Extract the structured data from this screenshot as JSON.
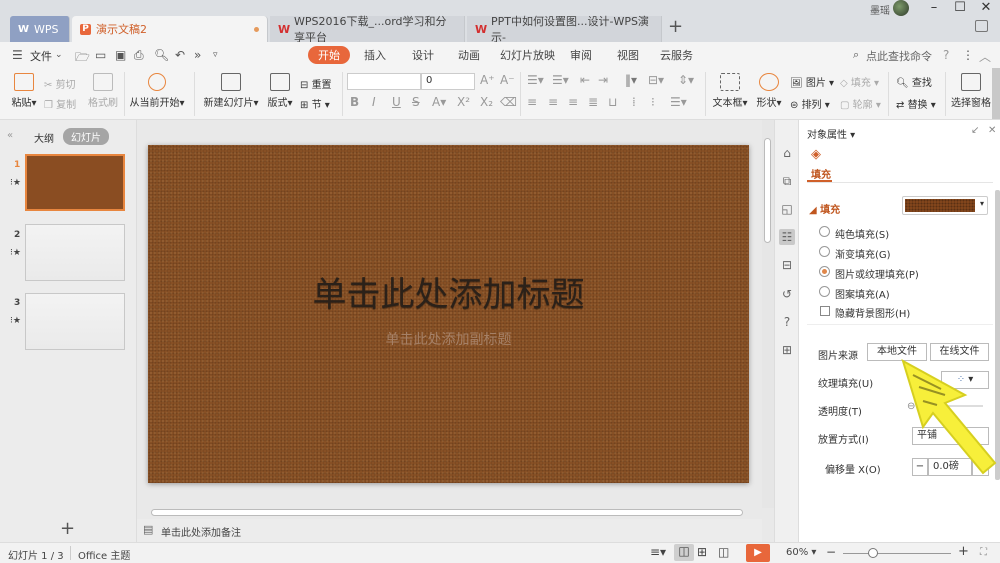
{
  "titlebar": {
    "tabs": [
      {
        "label": "WPS",
        "icon": "wps-icon"
      },
      {
        "label": "演示文稿2",
        "icon": "presentation-icon",
        "active": true,
        "unsaved": true
      },
      {
        "label": "WPS2016下载_...ord学习和分享平台",
        "icon": "wps-writer-icon"
      },
      {
        "label": "PPT中如何设置图...设计-WPS演示-",
        "icon": "wps-writer-icon"
      }
    ],
    "new_tab": "+",
    "user_name": "墨瑶",
    "window_controls": {
      "minimize": "–",
      "maximize": "☐",
      "close": "✕"
    }
  },
  "menubar": {
    "file_label": "文件",
    "tabs": [
      "开始",
      "插入",
      "设计",
      "动画",
      "幻灯片放映",
      "审阅",
      "视图",
      "云服务"
    ],
    "active_tab": "开始",
    "search_label": "点此查找命令",
    "help": "?",
    "more": "⋮",
    "collapse": "︿"
  },
  "ribbon": {
    "paste": "粘贴",
    "cut": "剪切",
    "copy": "复制",
    "format_painter": "格式刷",
    "play_from_current": "从当前开始",
    "new_slide": "新建幻灯片",
    "layout": "版式",
    "reset": "重置",
    "section": "节",
    "font_name": "",
    "font_size": "0",
    "textbox": "文本框",
    "shape": "形状",
    "picture": "图片",
    "arrange": "排列",
    "fill": "填充",
    "outline": "轮廓",
    "find": "查找",
    "replace": "替换",
    "selection_pane": "选择窗格"
  },
  "left_panel": {
    "outline_tab": "大纲",
    "slides_tab": "幻灯片",
    "slides": [
      {
        "number": "1",
        "selected": true
      },
      {
        "number": "2",
        "selected": false
      },
      {
        "number": "3",
        "selected": false
      }
    ],
    "add_slide": "+"
  },
  "slide": {
    "title_placeholder": "单击此处添加标题",
    "subtitle_placeholder": "单击此处添加副标题",
    "background_color": "#8b5226"
  },
  "notes": {
    "placeholder": "单击此处添加备注"
  },
  "properties": {
    "panel_title": "对象属性",
    "tab_fill": "填充",
    "section_fill": "填充",
    "options": [
      {
        "label": "纯色填充(S)",
        "selected": false
      },
      {
        "label": "渐变填充(G)",
        "selected": false
      },
      {
        "label": "图片或纹理填充(P)",
        "selected": true
      },
      {
        "label": "图案填充(A)",
        "selected": false
      }
    ],
    "hide_bg_graphics": "隐藏背景图形(H)",
    "picture_source_label": "图片来源",
    "local_file": "本地文件",
    "online_file": "在线文件",
    "texture_fill_label": "纹理填充(U)",
    "transparency_label": "透明度(T)",
    "placement_label": "放置方式(I)",
    "placement_value": "平铺",
    "offset_label": "偏移量 X(O)",
    "offset_value": "0.0磅",
    "accent_color": "#e0874a"
  },
  "status": {
    "slide_counter": "幻灯片 1 / 3",
    "theme": "Office 主题",
    "zoom": "60%",
    "zoom_level_percent": 60
  }
}
